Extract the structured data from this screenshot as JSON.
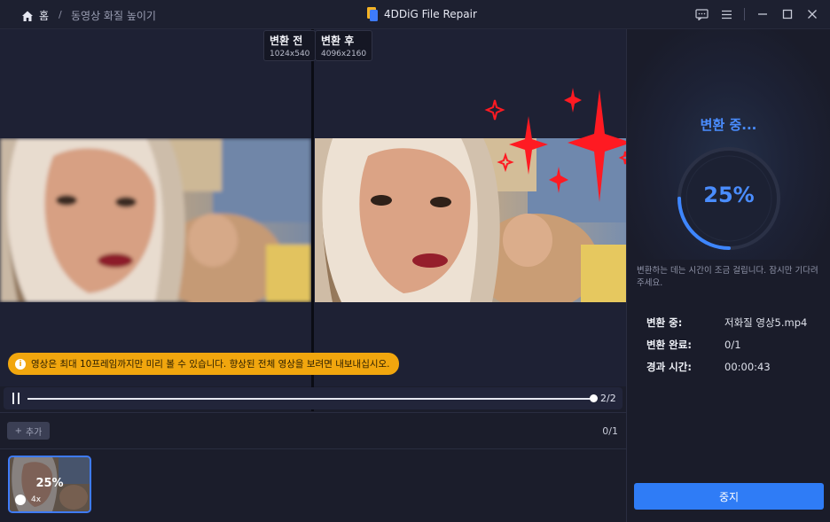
{
  "titlebar": {
    "home_label": "홈",
    "breadcrumb_sep": "/",
    "breadcrumb": "동영상 화질 높이기",
    "app_title": "4DDiG File Repair",
    "icons": [
      "feedback-icon",
      "menu-icon",
      "minimize-icon",
      "maximize-icon",
      "close-icon"
    ]
  },
  "preview": {
    "before_label": "변환 전",
    "before_res": "1024x540",
    "after_label": "변환 후",
    "after_res": "4096x2160",
    "notice": "영상은 최대 10프레임까지만 미리 볼 수 있습니다. 향상된 전체 영상을 보려면 내보내십시오.",
    "frame_counter": "2/2",
    "playback_progress": 1.0
  },
  "bottom": {
    "add_label": "추가",
    "file_count": "0/1",
    "thumb": {
      "progress": "25%",
      "scale": "4x"
    }
  },
  "panel": {
    "status_title": "변환 중...",
    "progress_text": "25%",
    "progress_value": 0.25,
    "note": "변환하는 데는 시간이 조금 걸립니다. 잠시만 기다려 주세요.",
    "stats": [
      {
        "key": "변환 중:",
        "value": "저화질 영상5.mp4"
      },
      {
        "key": "변환 완료:",
        "value": "0/1"
      },
      {
        "key": "경과 시간:",
        "value": "00:00:43"
      }
    ],
    "stop_label": "중지"
  },
  "colors": {
    "accent": "#3e7bfa",
    "notice": "#f1a60e",
    "sparkle": "#ff1a22"
  }
}
